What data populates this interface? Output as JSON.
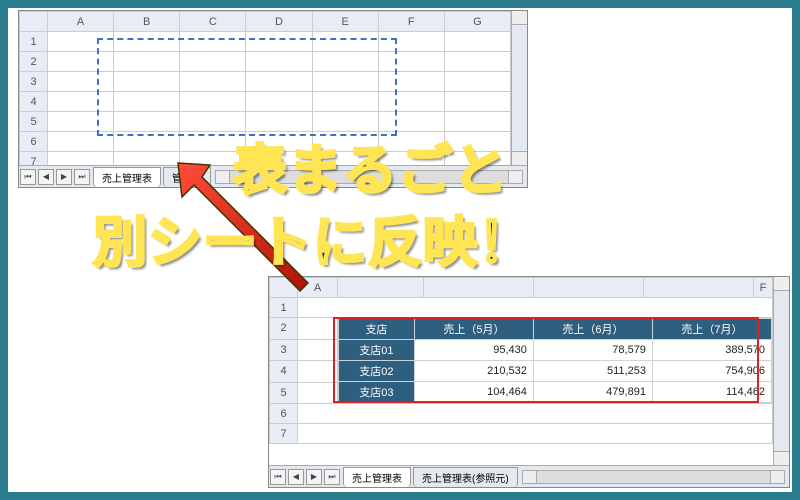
{
  "border_color": "#2a7b8c",
  "headline": {
    "line1": "表まるごと",
    "line2": "別シートに反映！"
  },
  "excel1": {
    "cols": [
      "A",
      "B",
      "C",
      "D",
      "E",
      "F",
      "G"
    ],
    "rows": [
      "1",
      "2",
      "3",
      "4",
      "5",
      "6",
      "7"
    ],
    "tabs": [
      {
        "label": "売上管理表",
        "active": true
      },
      {
        "label": "管理表",
        "active": false
      }
    ]
  },
  "excel2": {
    "cols": [
      "A",
      "",
      "",
      "",
      "",
      "F"
    ],
    "rows": [
      "1",
      "2",
      "3",
      "4",
      "5",
      "6",
      "7"
    ],
    "tabs": [
      {
        "label": "売上管理表",
        "active": true
      },
      {
        "label": "売上管理表(参照元)",
        "active": false
      }
    ],
    "table": {
      "headers": [
        "支店",
        "売上（5月）",
        "売上（6月）",
        "売上（7月）"
      ],
      "rows": [
        {
          "branch": "支店01",
          "v": [
            "95,430",
            "78,579",
            "389,570"
          ]
        },
        {
          "branch": "支店02",
          "v": [
            "210,532",
            "511,253",
            "754,906"
          ]
        },
        {
          "branch": "支店03",
          "v": [
            "104,464",
            "479,891",
            "114,462"
          ]
        }
      ]
    }
  }
}
